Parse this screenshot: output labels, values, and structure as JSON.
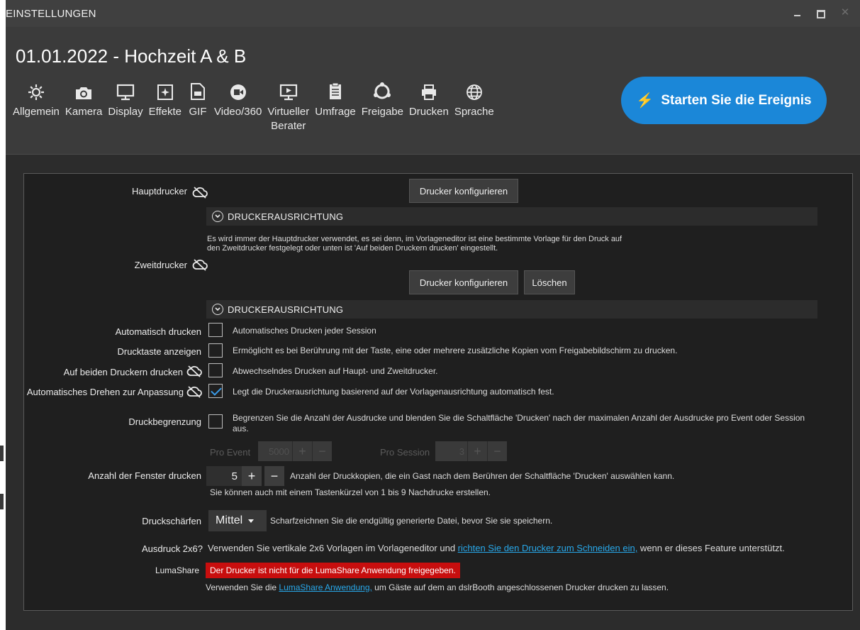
{
  "window": {
    "title": "EINSTELLUNGEN"
  },
  "event": {
    "title": "01.01.2022 - Hochzeit A & B"
  },
  "toolbar": {
    "items": [
      {
        "label": "Allgemein",
        "icon": "gear-icon"
      },
      {
        "label": "Kamera",
        "icon": "camera-icon"
      },
      {
        "label": "Display",
        "icon": "monitor-icon"
      },
      {
        "label": "Effekte",
        "icon": "effects-icon"
      },
      {
        "label": "GIF",
        "icon": "gif-file-icon"
      },
      {
        "label": "Video/360",
        "icon": "video-icon"
      },
      {
        "label": "Virtueller\nBerater",
        "icon": "presentation-icon"
      },
      {
        "label": "Umfrage",
        "icon": "clipboard-icon"
      },
      {
        "label": "Freigabe",
        "icon": "share-icon"
      },
      {
        "label": "Drucken",
        "icon": "printer-icon"
      },
      {
        "label": "Sprache",
        "icon": "globe-icon"
      }
    ],
    "start_label": "Starten Sie die Ereignis"
  },
  "printers": {
    "main_label": "Hauptdrucker",
    "configure_label": "Drucker konfigurieren",
    "orientation_label": "DRUCKERAUSRICHTUNG",
    "second_label": "Zweitdrucker",
    "second_note": "Es wird immer der Hauptdrucker verwendet, es sei denn, im Vorlageneditor ist eine bestimmte Vorlage für den Druck auf den Zweitdrucker festgelegt oder unten ist 'Auf beiden Druckern drucken' eingestellt.",
    "delete_label": "Löschen"
  },
  "options": [
    {
      "label": "Automatisch drucken",
      "desc": "Automatisches Drucken jeder Session",
      "checked": false,
      "cloud": false
    },
    {
      "label": "Drucktaste anzeigen",
      "desc": "Ermöglicht es bei Berührung mit der Taste, eine oder mehrere zusätzliche Kopien vom Freigabebildschirm zu drucken.",
      "checked": false,
      "cloud": false
    },
    {
      "label": "Auf beiden Druckern drucken",
      "desc": "Abwechselndes Drucken auf Haupt- und Zweitdrucker.",
      "checked": false,
      "cloud": true
    },
    {
      "label": "Automatisches Drehen zur Anpassung",
      "desc": "Legt die Druckerausrichtung basierend auf der Vorlagenausrichtung automatisch fest.",
      "checked": true,
      "cloud": true
    },
    {
      "label": "Druckbegrenzung",
      "desc": "Begrenzen Sie die Anzahl der Ausdrucke und blenden Sie die Schaltfläche 'Drucken' nach der maximalen Anzahl der Ausdrucke pro Event oder Session aus.",
      "checked": false,
      "cloud": false
    }
  ],
  "limits": {
    "per_event_label": "Pro Event",
    "per_event_value": "5000",
    "per_session_label": "Pro Session",
    "per_session_value": "3"
  },
  "copies": {
    "label": "Anzahl der Fenster drucken",
    "value": "5",
    "desc": "Anzahl der Druckkopien, die ein Gast nach dem Berühren der Schaltfläche 'Drucken' auswählen kann.",
    "note": "Sie können auch mit einem Tastenkürzel von 1 bis 9 Nachdrucke erstellen."
  },
  "sharpen": {
    "label": "Druckschärfen",
    "value": "Mittel",
    "desc": "Scharfzeichnen Sie die endgültig generierte Datei, bevor Sie sie speichern."
  },
  "print2x6": {
    "label": "Ausdruck 2x6?",
    "text_before": "Verwenden Sie vertikale 2x6 Vorlagen im Vorlageneditor und ",
    "link": "richten Sie den Drucker zum Schneiden ein,",
    "text_after": " wenn er dieses Feature unterstützt."
  },
  "lumashare": {
    "label": "LumaShare",
    "warning": "Der Drucker ist nicht für die LumaShare Anwendung freigegeben.",
    "text_before": "Verwenden Sie die ",
    "link": "LumaShare Anwendung,",
    "text_after": " um Gäste auf dem an dslrBooth angeschlossenen Drucker drucken zu lassen."
  },
  "colors": {
    "accent": "#1b87d8",
    "link": "#28a8ea",
    "warning": "#c80e0e",
    "check": "#3a9be8"
  }
}
